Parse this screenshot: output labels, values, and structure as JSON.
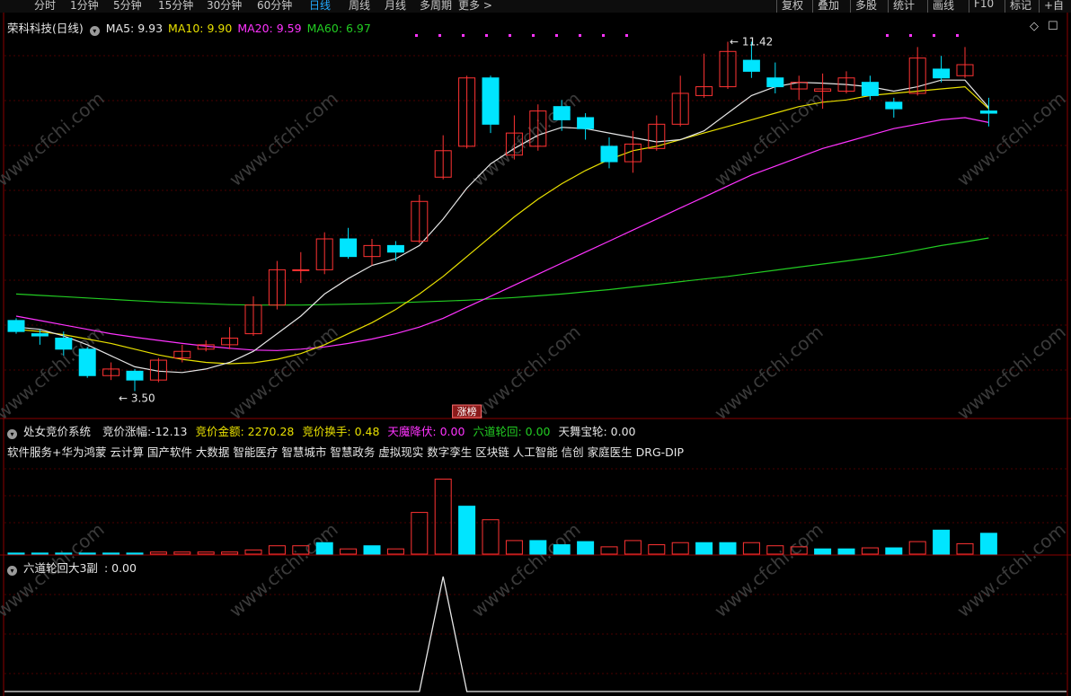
{
  "topbar": {
    "left_tabs": [
      "分时",
      "1分钟",
      "5分钟",
      "15分钟",
      "30分钟",
      "60分钟",
      "日线",
      "周线",
      "月线",
      "多周期",
      "更多 >"
    ],
    "active_tab": "日线",
    "right_buttons": [
      "复权",
      "叠加",
      "多股",
      "统计",
      "画线",
      "F10",
      "标记",
      "+自"
    ]
  },
  "main_panel": {
    "stock_title": "荣科科技(日线)",
    "ma": [
      {
        "label": "MA5: 9.93",
        "color": "#e6e6e6"
      },
      {
        "label": "MA10: 9.90",
        "color": "#e8e000"
      },
      {
        "label": "MA20: 9.59",
        "color": "#ff33ff"
      },
      {
        "label": "MA60: 6.97",
        "color": "#22cc22"
      }
    ],
    "high_marker": "11.42",
    "low_marker": "3.50",
    "event_badge": "涨榜",
    "watermark": "www.cfchi.com"
  },
  "sub_panel_1": {
    "system": "处女竞价系统",
    "fields": [
      {
        "label": "竞价涨幅:-12.13",
        "color": "#e6e6e6"
      },
      {
        "label": "竞价金额: 2270.28",
        "color": "#e8e000"
      },
      {
        "label": "竞价换手: 0.48",
        "color": "#e8e000"
      },
      {
        "label": "天魔降伏: 0.00",
        "color": "#ff33ff"
      },
      {
        "label": "六道轮回: 0.00",
        "color": "#22cc22"
      },
      {
        "label": "天舞宝轮: 0.00",
        "color": "#e6e6e6"
      }
    ],
    "concepts": "软件服务+华为鸿蒙 云计算 国产软件 大数据 智能医疗 智慧城市 智慧政务 虚拟现实 数字孪生 区块链 人工智能 信创 家庭医生 DRG-DIP"
  },
  "sub_panel_2": {
    "title": "六道轮回大3副",
    "value": ": 0.00"
  },
  "chart_data": {
    "type": "candlestick",
    "colors": {
      "up": "#ff3333",
      "down": "#00e5ff",
      "ma5": "#e6e6e6",
      "ma10": "#e8e000",
      "ma20": "#ff33ff",
      "ma60": "#22cc22",
      "grid": "#4a0000"
    },
    "candles": [
      {
        "o": 5.1,
        "c": 4.85,
        "h": 5.15,
        "l": 4.8
      },
      {
        "o": 4.8,
        "c": 4.75,
        "h": 4.9,
        "l": 4.55
      },
      {
        "o": 4.7,
        "c": 4.45,
        "h": 4.85,
        "l": 4.3
      },
      {
        "o": 4.45,
        "c": 3.85,
        "h": 4.5,
        "l": 3.8
      },
      {
        "o": 3.85,
        "c": 4.0,
        "h": 4.15,
        "l": 3.75
      },
      {
        "o": 3.95,
        "c": 3.75,
        "h": 4.0,
        "l": 3.5
      },
      {
        "o": 3.75,
        "c": 4.2,
        "h": 4.25,
        "l": 3.7
      },
      {
        "o": 4.25,
        "c": 4.4,
        "h": 4.55,
        "l": 4.15
      },
      {
        "o": 4.45,
        "c": 4.55,
        "h": 4.65,
        "l": 4.4
      },
      {
        "o": 4.55,
        "c": 4.7,
        "h": 4.95,
        "l": 4.45
      },
      {
        "o": 4.8,
        "c": 5.45,
        "h": 5.65,
        "l": 4.75
      },
      {
        "o": 5.45,
        "c": 6.25,
        "h": 6.45,
        "l": 5.35
      },
      {
        "o": 6.25,
        "c": 6.25,
        "h": 6.65,
        "l": 5.95
      },
      {
        "o": 6.25,
        "c": 6.95,
        "h": 7.1,
        "l": 6.15
      },
      {
        "o": 6.95,
        "c": 6.55,
        "h": 7.2,
        "l": 6.5
      },
      {
        "o": 6.55,
        "c": 6.8,
        "h": 6.95,
        "l": 6.35
      },
      {
        "o": 6.8,
        "c": 6.65,
        "h": 6.9,
        "l": 6.45
      },
      {
        "o": 6.9,
        "c": 7.8,
        "h": 7.95,
        "l": 6.85
      },
      {
        "o": 8.35,
        "c": 8.95,
        "h": 9.3,
        "l": 8.3
      },
      {
        "o": 9.05,
        "c": 10.6,
        "h": 10.65,
        "l": 9.0
      },
      {
        "o": 10.6,
        "c": 9.55,
        "h": 10.65,
        "l": 9.35
      },
      {
        "o": 8.85,
        "c": 9.35,
        "h": 9.75,
        "l": 8.75
      },
      {
        "o": 9.05,
        "c": 9.85,
        "h": 10.0,
        "l": 8.95
      },
      {
        "o": 9.95,
        "c": 9.65,
        "h": 10.1,
        "l": 9.4
      },
      {
        "o": 9.7,
        "c": 9.45,
        "h": 9.8,
        "l": 9.2
      },
      {
        "o": 9.05,
        "c": 8.7,
        "h": 9.25,
        "l": 8.55
      },
      {
        "o": 8.7,
        "c": 9.1,
        "h": 9.4,
        "l": 8.45
      },
      {
        "o": 9.0,
        "c": 9.55,
        "h": 9.75,
        "l": 8.95
      },
      {
        "o": 9.55,
        "c": 10.25,
        "h": 10.65,
        "l": 9.5
      },
      {
        "o": 10.2,
        "c": 10.4,
        "h": 11.15,
        "l": 10.15
      },
      {
        "o": 10.4,
        "c": 11.2,
        "h": 11.42,
        "l": 10.35
      },
      {
        "o": 11.0,
        "c": 10.75,
        "h": 11.42,
        "l": 10.6
      },
      {
        "o": 10.6,
        "c": 10.4,
        "h": 10.95,
        "l": 10.25
      },
      {
        "o": 10.35,
        "c": 10.5,
        "h": 10.65,
        "l": 10.1
      },
      {
        "o": 10.3,
        "c": 10.35,
        "h": 10.7,
        "l": 9.9
      },
      {
        "o": 10.3,
        "c": 10.6,
        "h": 10.75,
        "l": 10.25
      },
      {
        "o": 10.5,
        "c": 10.2,
        "h": 10.65,
        "l": 10.1
      },
      {
        "o": 10.05,
        "c": 9.9,
        "h": 10.15,
        "l": 9.7
      },
      {
        "o": 10.25,
        "c": 11.05,
        "h": 11.3,
        "l": 10.2
      },
      {
        "o": 10.8,
        "c": 10.6,
        "h": 11.1,
        "l": 10.5
      },
      {
        "o": 10.65,
        "c": 10.9,
        "h": 11.3,
        "l": 10.6
      },
      {
        "o": 9.85,
        "c": 9.8,
        "h": 10.15,
        "l": 9.5
      }
    ],
    "ma5": [
      4.95,
      4.9,
      4.75,
      4.55,
      4.3,
      4.05,
      3.95,
      3.92,
      4.0,
      4.15,
      4.4,
      4.8,
      5.2,
      5.7,
      6.05,
      6.35,
      6.5,
      6.8,
      7.4,
      8.1,
      8.65,
      9.0,
      9.3,
      9.48,
      9.45,
      9.35,
      9.25,
      9.15,
      9.2,
      9.4,
      9.8,
      10.2,
      10.4,
      10.5,
      10.48,
      10.45,
      10.4,
      10.3,
      10.4,
      10.55,
      10.55,
      9.93
    ],
    "ma10": [
      4.9,
      4.85,
      4.78,
      4.68,
      4.58,
      4.45,
      4.32,
      4.22,
      4.15,
      4.12,
      4.14,
      4.22,
      4.35,
      4.55,
      4.8,
      5.05,
      5.35,
      5.7,
      6.1,
      6.55,
      7.0,
      7.45,
      7.85,
      8.2,
      8.5,
      8.75,
      8.95,
      9.05,
      9.2,
      9.35,
      9.5,
      9.65,
      9.8,
      9.95,
      10.05,
      10.1,
      10.2,
      10.25,
      10.3,
      10.35,
      10.4,
      9.9
    ],
    "ma20": [
      5.2,
      5.1,
      5.0,
      4.9,
      4.8,
      4.72,
      4.65,
      4.58,
      4.52,
      4.47,
      4.43,
      4.42,
      4.45,
      4.5,
      4.58,
      4.68,
      4.8,
      4.95,
      5.15,
      5.4,
      5.65,
      5.9,
      6.15,
      6.4,
      6.65,
      6.9,
      7.15,
      7.4,
      7.65,
      7.9,
      8.15,
      8.4,
      8.6,
      8.8,
      9.0,
      9.15,
      9.3,
      9.45,
      9.55,
      9.65,
      9.7,
      9.59
    ],
    "ma60": [
      5.7,
      5.67,
      5.64,
      5.61,
      5.58,
      5.55,
      5.52,
      5.5,
      5.48,
      5.46,
      5.45,
      5.45,
      5.45,
      5.46,
      5.47,
      5.48,
      5.5,
      5.52,
      5.54,
      5.56,
      5.59,
      5.62,
      5.66,
      5.7,
      5.75,
      5.8,
      5.86,
      5.92,
      5.98,
      6.04,
      6.1,
      6.17,
      6.24,
      6.31,
      6.38,
      6.45,
      6.52,
      6.6,
      6.7,
      6.8,
      6.88,
      6.97
    ],
    "auction_bars": [
      1,
      1,
      1,
      1,
      1,
      1,
      2,
      2,
      2,
      2,
      4,
      8,
      8,
      11,
      5,
      8,
      5,
      40,
      72,
      46,
      33,
      13,
      13,
      9,
      12,
      7,
      13,
      9,
      11,
      11,
      11,
      11,
      8,
      7,
      5,
      5,
      6,
      6,
      12,
      23,
      10,
      20
    ],
    "auction_up": [
      0,
      0,
      0,
      0,
      0,
      0,
      1,
      1,
      1,
      1,
      1,
      1,
      1,
      0,
      1,
      0,
      1,
      1,
      1,
      0,
      1,
      1,
      0,
      0,
      0,
      1,
      1,
      1,
      1,
      0,
      0,
      1,
      1,
      1,
      0,
      0,
      1,
      0,
      1,
      0,
      1,
      0
    ],
    "signal_line": [
      0,
      0,
      0,
      0,
      0,
      0,
      0,
      0,
      0,
      0,
      0,
      0,
      0,
      0,
      0,
      0,
      0,
      0,
      1,
      0,
      0,
      0,
      0,
      0,
      0,
      0,
      0,
      0,
      0,
      0,
      0,
      0,
      0,
      0,
      0,
      0,
      0,
      0,
      0,
      0,
      0,
      0
    ]
  }
}
